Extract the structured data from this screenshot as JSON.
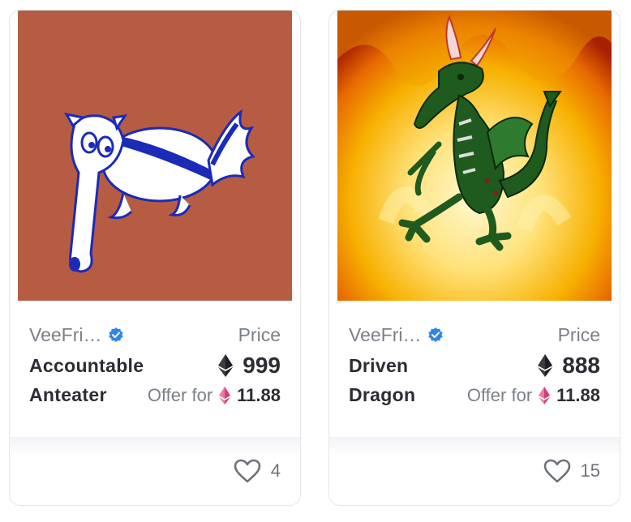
{
  "cards": [
    {
      "creator": "VeeFri…",
      "price_label": "Price",
      "name_line1": "Accountable",
      "name_line2": "Anteater",
      "price": "999",
      "offer_label": "Offer for",
      "offer_value": "11.88",
      "likes": "4",
      "art_background": "#b65c43"
    },
    {
      "creator": "VeeFri…",
      "price_label": "Price",
      "name_line1": "Driven",
      "name_line2": "Dragon",
      "price": "888",
      "offer_label": "Offer for",
      "offer_value": "11.88",
      "likes": "15",
      "art_background": "#f5b400"
    }
  ],
  "colors": {
    "verified": "#2f86e8",
    "offer_eth": "#e0508a",
    "text_dark": "#2b2d33",
    "text_muted": "#7b8088"
  }
}
